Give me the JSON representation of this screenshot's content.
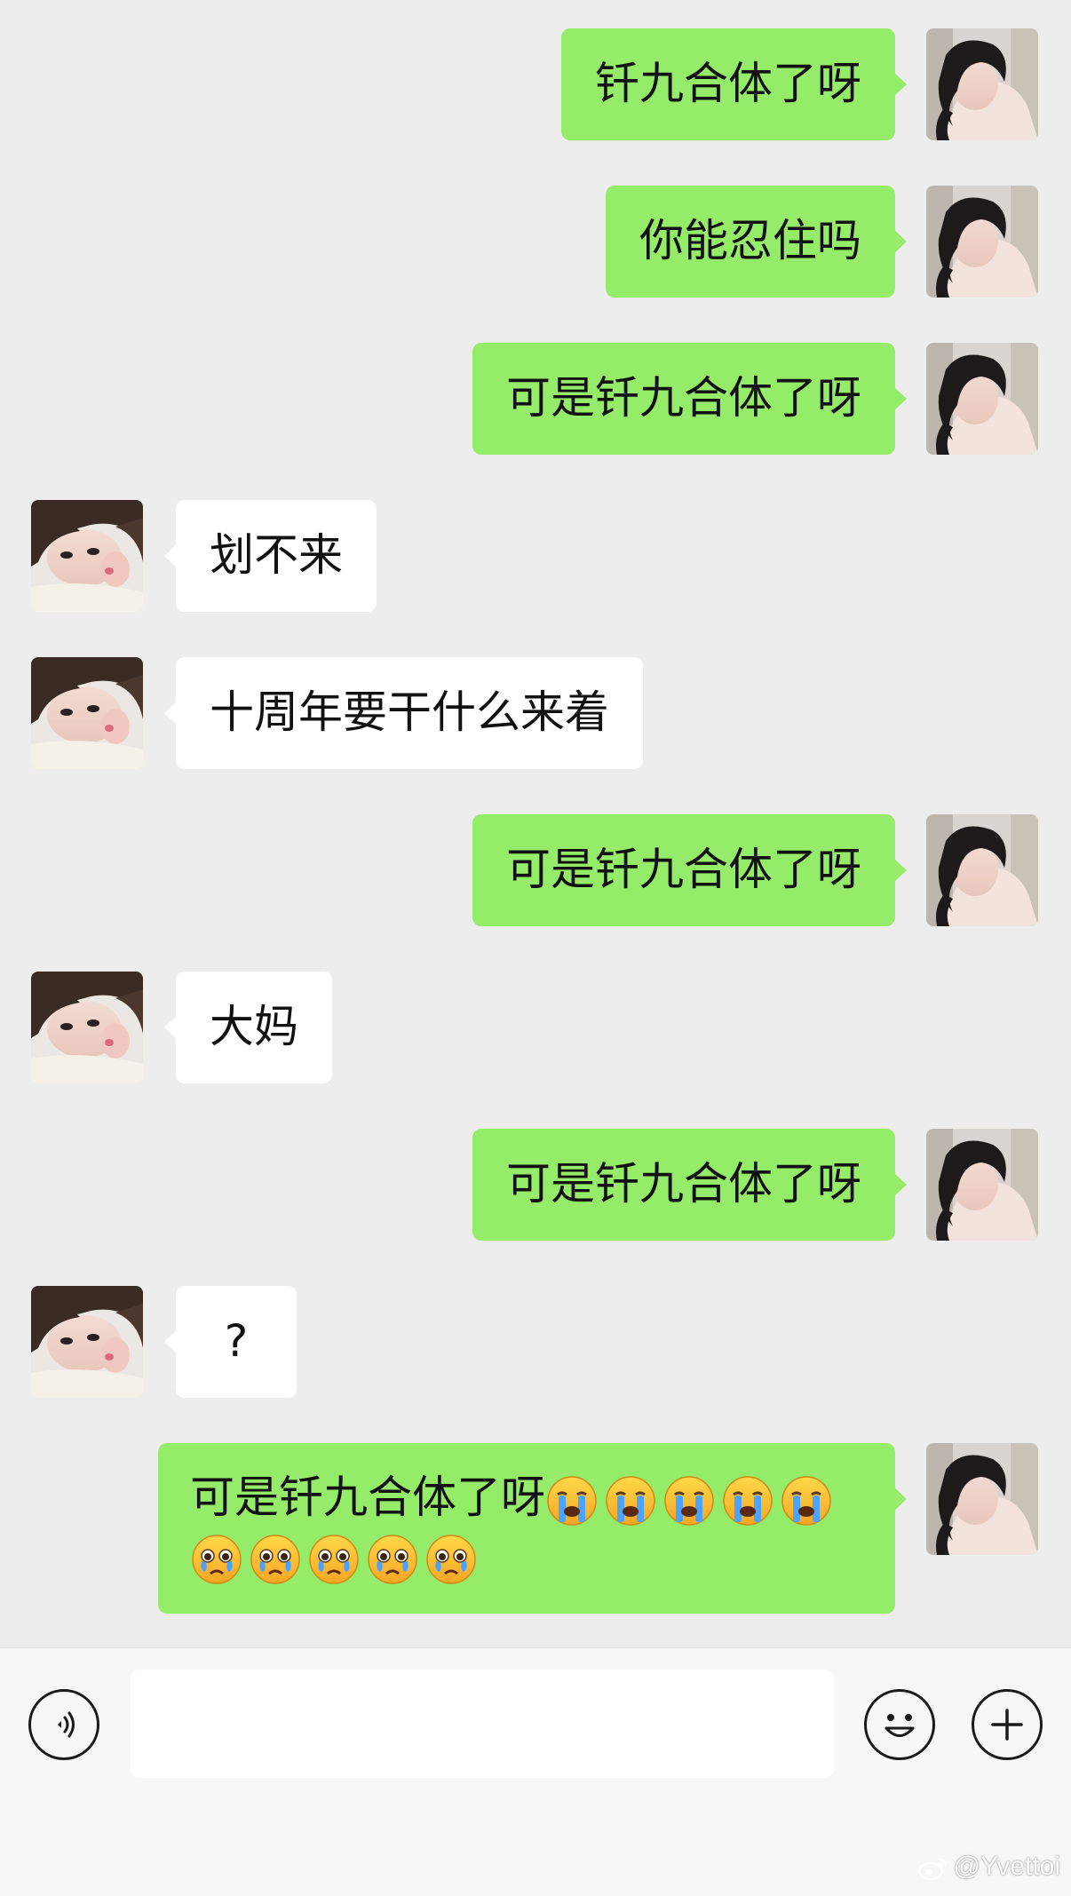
{
  "messages": [
    {
      "side": "me",
      "text": "钎九合体了呀"
    },
    {
      "side": "me",
      "text": "你能忍住吗"
    },
    {
      "side": "me",
      "text": "可是钎九合体了呀"
    },
    {
      "side": "other",
      "text": "划不来"
    },
    {
      "side": "other",
      "text": "十周年要干什么来着"
    },
    {
      "side": "me",
      "text": "可是钎九合体了呀"
    },
    {
      "side": "other",
      "text": "大妈"
    },
    {
      "side": "me",
      "text": "可是钎九合体了呀"
    },
    {
      "side": "other",
      "text": "?"
    },
    {
      "side": "me",
      "text": "可是钎九合体了呀",
      "emojis_line1": [
        "loudly-crying-emoji",
        "loudly-crying-emoji",
        "loudly-crying-emoji",
        "loudly-crying-emoji",
        "loudly-crying-emoji"
      ],
      "emojis_line2": [
        "pleading-crying-emoji",
        "pleading-crying-emoji",
        "pleading-crying-emoji",
        "pleading-crying-emoji",
        "pleading-crying-emoji"
      ]
    }
  ],
  "input": {
    "value": "",
    "voice_icon": "voice-icon",
    "emoji_icon": "smiley-icon",
    "plus_icon": "plus-icon"
  },
  "watermark": {
    "text": "@Yvettoi",
    "logo_icon": "weibo-logo-icon"
  },
  "colors": {
    "background": "#ededed",
    "my_bubble": "#95ec69",
    "other_bubble": "#ffffff"
  }
}
